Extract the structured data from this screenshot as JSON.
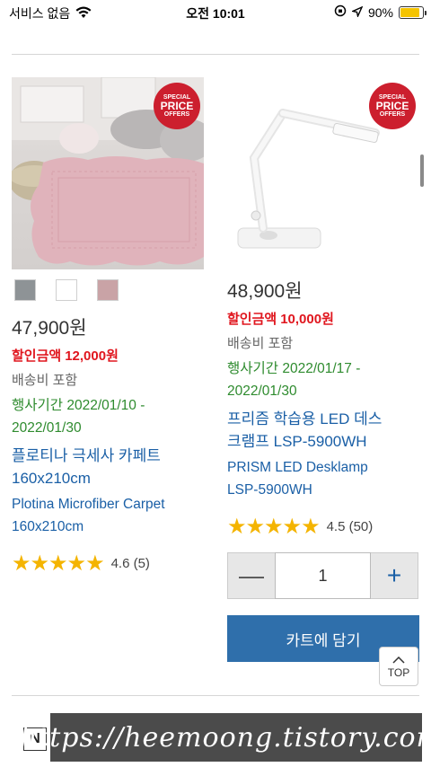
{
  "status_bar": {
    "carrier": "서비스 없음",
    "time": "오전 10:01",
    "battery": "90%"
  },
  "badge": {
    "line1": "SPECIAL",
    "line2": "PRICE",
    "line3": "OFFERS"
  },
  "products": [
    {
      "price": "47,900원",
      "discount_label": "할인금액",
      "discount_amount": "12,000원",
      "shipping": "배송비 포함",
      "period_line1": "행사기간 2022/01/10 -",
      "period_line2": "2022/01/30",
      "title_ko_line1": "플로티나 극세사 카페트",
      "title_ko_line2": "160x210cm",
      "title_en_line1": "Plotina Microfiber Carpet",
      "title_en_line2": "160x210cm",
      "stars": "★★★★★",
      "rating": "4.6 (5)",
      "swatch_colors": [
        "#8e9396",
        "#ffffff",
        "#c9a3a6"
      ]
    },
    {
      "price": "48,900원",
      "discount_label": "할인금액",
      "discount_amount": "10,000원",
      "shipping": "배송비 포함",
      "period_line1": "행사기간 2022/01/17 -",
      "period_line2": "2022/01/30",
      "title_ko_line1": "프리즘 학습용 LED 데스",
      "title_ko_line2": "크램프 LSP-5900WH",
      "title_en_line1": "PRISM LED Desklamp",
      "title_en_line2": "LSP-5900WH",
      "stars": "★★★★★",
      "rating": "4.5 (50)",
      "quantity": "1",
      "minus": "—",
      "plus": "+",
      "cart_button": "카트에 담기"
    }
  ],
  "top_button": {
    "label": "TOP"
  },
  "bottom": {
    "logo": "N",
    "watermark": "https://heemoong.tistory.com/"
  }
}
